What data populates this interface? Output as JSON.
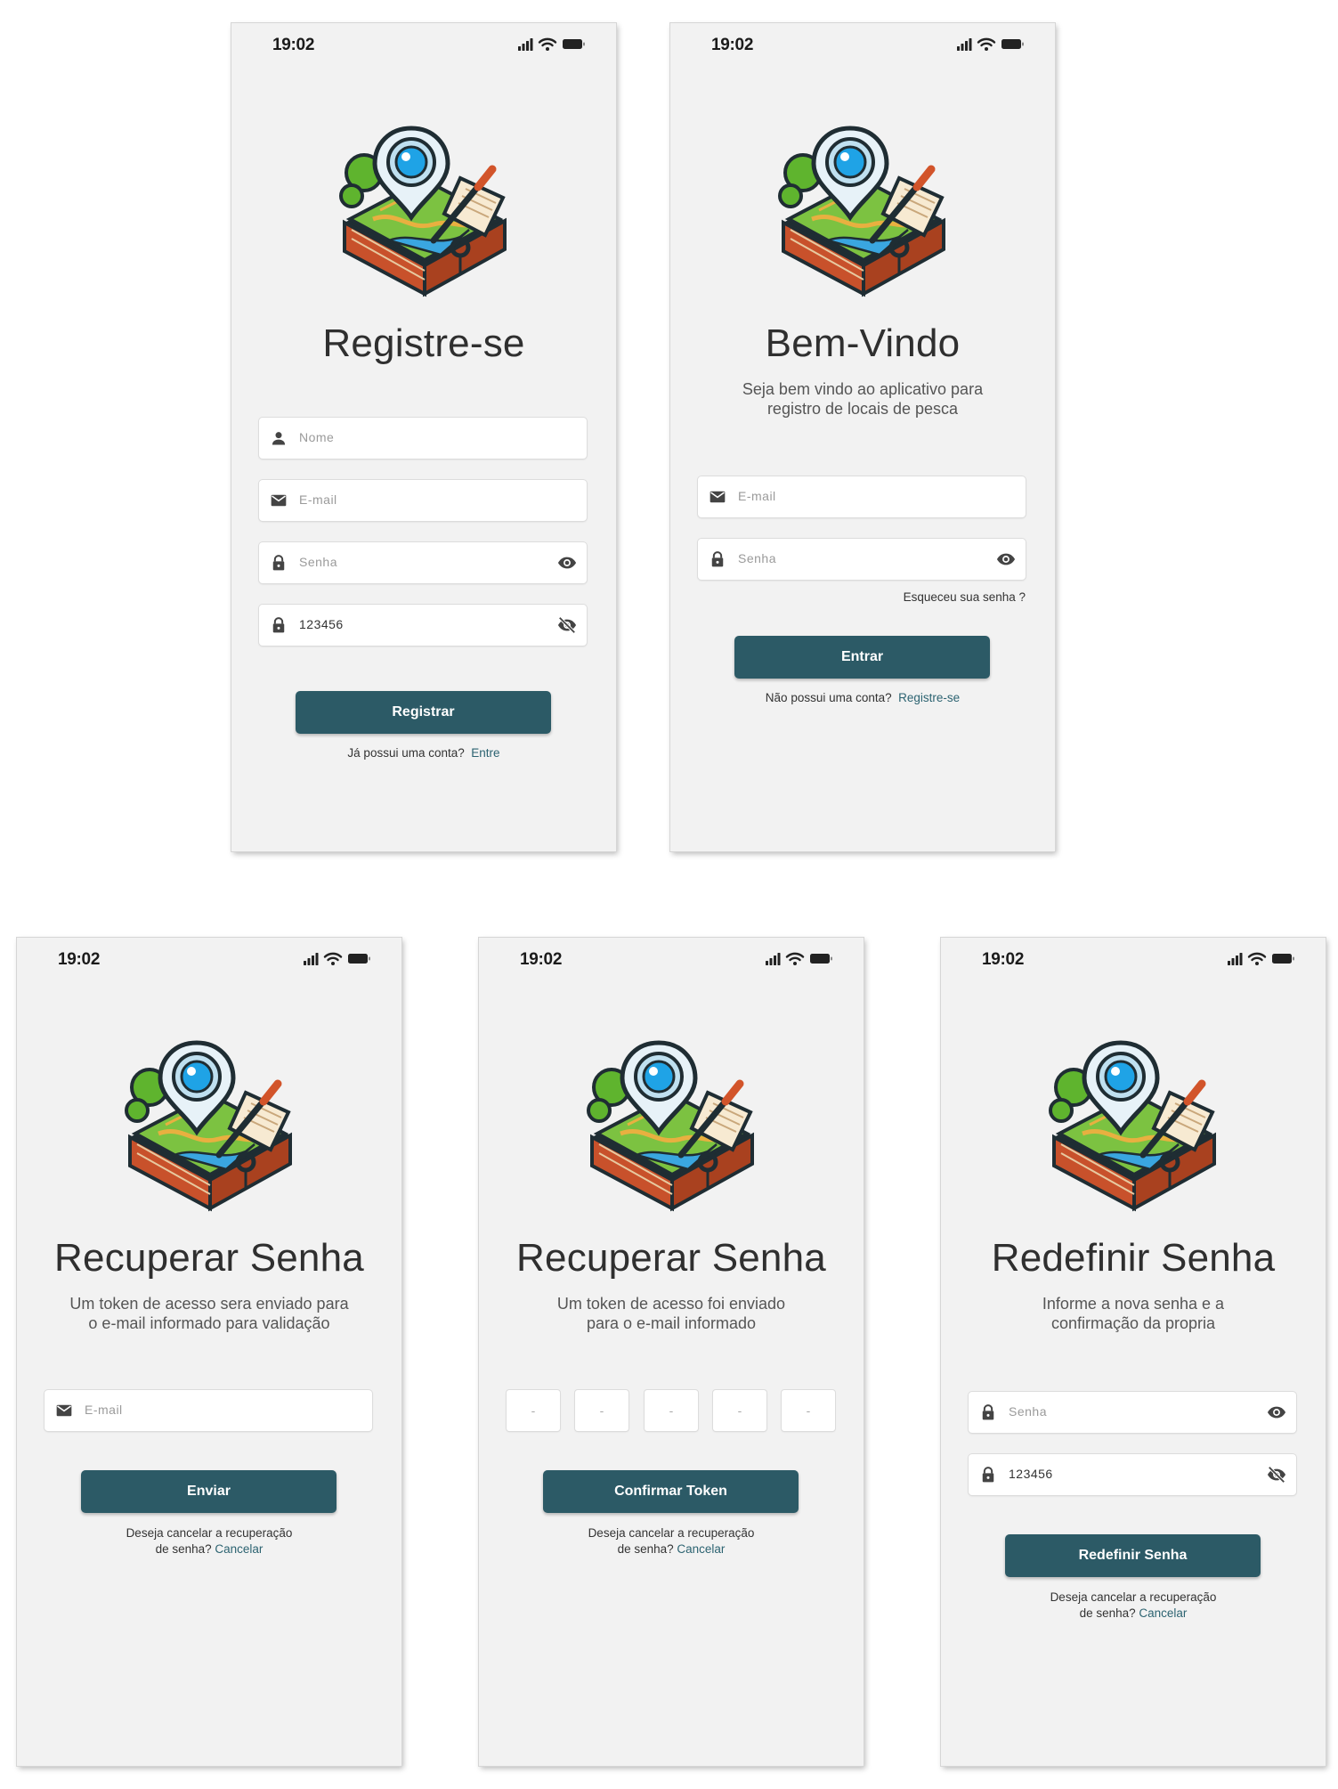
{
  "status": {
    "time": "19:02"
  },
  "screens": {
    "register": {
      "title": "Registre-se",
      "fields": {
        "name_placeholder": "Nome",
        "email_placeholder": "E-mail",
        "password_placeholder": "Senha",
        "confirm_value": "123456"
      },
      "button": "Registrar",
      "footer_text": "Já possui uma conta?",
      "footer_link": "Entre"
    },
    "login": {
      "title": "Bem-Vindo",
      "subtitle_line1": "Seja bem vindo ao aplicativo para",
      "subtitle_line2": "registro de locais de pesca",
      "fields": {
        "email_placeholder": "E-mail",
        "password_placeholder": "Senha"
      },
      "forgot": "Esqueceu sua senha ?",
      "button": "Entrar",
      "footer_text": "Não possui uma conta?",
      "footer_link": "Registre-se"
    },
    "recover": {
      "title": "Recuperar Senha",
      "subtitle_line1": "Um token de acesso sera enviado para",
      "subtitle_line2": "o e-mail informado para validação",
      "fields": {
        "email_placeholder": "E-mail"
      },
      "button": "Enviar",
      "footer_line1": "Deseja cancelar a recuperação",
      "footer_line2": "de senha?",
      "footer_link": "Cancelar"
    },
    "token": {
      "title": "Recuperar Senha",
      "subtitle_line1": "Um token de acesso foi enviado",
      "subtitle_line2": "para o e-mail informado",
      "token_placeholder": "-",
      "button": "Confirmar Token",
      "footer_line1": "Deseja cancelar a recuperação",
      "footer_line2": "de senha?",
      "footer_link": "Cancelar"
    },
    "reset": {
      "title": "Redefinir Senha",
      "subtitle_line1": "Informe a nova senha e a",
      "subtitle_line2": "confirmação da propria",
      "fields": {
        "password_placeholder": "Senha",
        "confirm_value": "123456"
      },
      "button": "Redefinir Senha",
      "footer_line1": "Deseja cancelar a recuperação",
      "footer_line2": "de senha?",
      "footer_link": "Cancelar"
    }
  },
  "colors": {
    "primary": "#2c5a66",
    "link": "#2c6371",
    "screen_bg": "#f2f2f2"
  },
  "icons": [
    "user-icon",
    "mail-icon",
    "lock-icon",
    "eye-icon",
    "eye-off-icon",
    "signal-icon",
    "wifi-icon",
    "battery-icon",
    "app-logo-map-pin-fishing"
  ]
}
